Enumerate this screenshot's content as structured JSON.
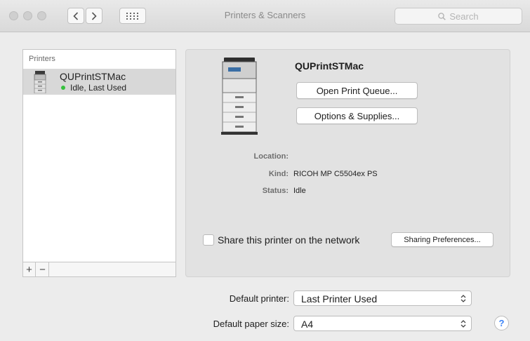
{
  "window": {
    "title": "Printers & Scanners",
    "search_placeholder": "Search"
  },
  "sidebar": {
    "header": "Printers",
    "printers": [
      {
        "name": "QUPrintSTMac",
        "status": "Idle, Last Used",
        "status_color": "#36c13e"
      }
    ],
    "add_label": "+",
    "remove_label": "−"
  },
  "detail": {
    "printer_name": "QUPrintSTMac",
    "open_queue_label": "Open Print Queue...",
    "options_label": "Options & Supplies...",
    "location_label": "Location:",
    "location_value": "",
    "kind_label": "Kind:",
    "kind_value": "RICOH MP C5504ex PS",
    "status_label": "Status:",
    "status_value": "Idle",
    "share_label": "Share this printer on the network",
    "share_checked": false,
    "sharing_prefs_label": "Sharing Preferences..."
  },
  "bottom": {
    "default_printer_label": "Default printer:",
    "default_printer_value": "Last Printer Used",
    "paper_size_label": "Default paper size:",
    "paper_size_value": "A4",
    "help_label": "?"
  },
  "colors": {
    "accent": "#3b82f6",
    "idle_dot": "#36c13e"
  }
}
